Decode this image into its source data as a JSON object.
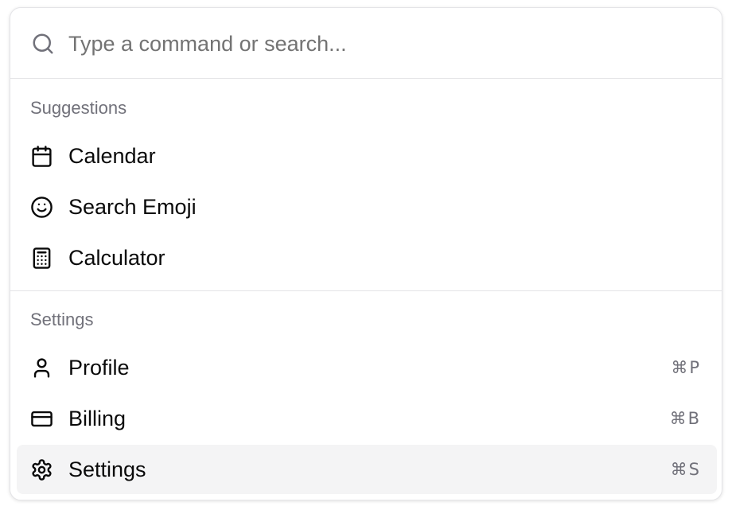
{
  "search": {
    "placeholder": "Type a command or search...",
    "value": ""
  },
  "groups": [
    {
      "heading": "Suggestions",
      "items": [
        {
          "label": "Calendar",
          "icon": "calendar-icon"
        },
        {
          "label": "Search Emoji",
          "icon": "smile-icon"
        },
        {
          "label": "Calculator",
          "icon": "calculator-icon"
        }
      ]
    },
    {
      "heading": "Settings",
      "items": [
        {
          "label": "Profile",
          "icon": "user-icon",
          "shortcut": "⌘P"
        },
        {
          "label": "Billing",
          "icon": "credit-card-icon",
          "shortcut": "⌘B"
        },
        {
          "label": "Settings",
          "icon": "settings-gear-icon",
          "shortcut": "⌘S",
          "selected": true
        }
      ]
    }
  ],
  "colors": {
    "border": "#e4e4e7",
    "muted_text": "#71717a",
    "selected_bg": "#f4f4f5",
    "text": "#0a0a0a"
  }
}
